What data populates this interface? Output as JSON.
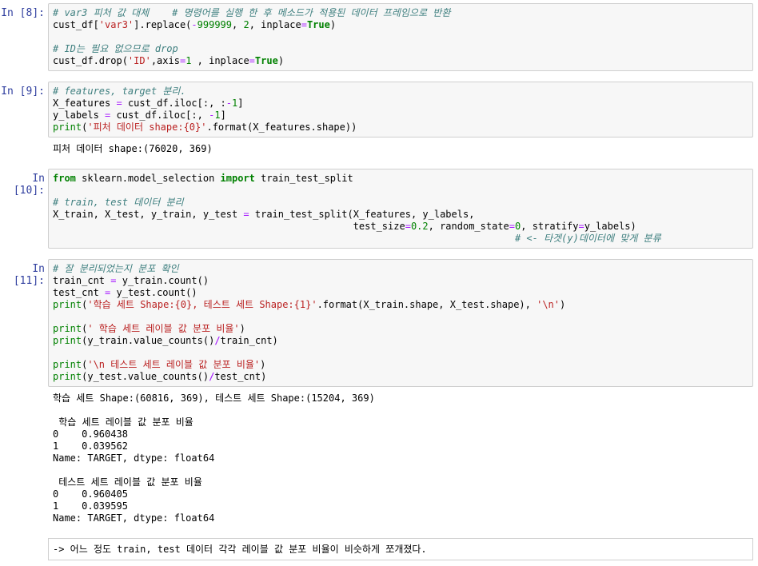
{
  "cells": [
    {
      "prompt": "In [8]:",
      "lines": [
        "# var3 피처 값 대체    # 명령어를 실행 한 후 메소드가 적용된 데이터 프레임으로 반환",
        "cust_df['var3'].replace(-999999, 2, inplace=True)",
        "",
        "# ID는 필요 없으므로 drop",
        "cust_df.drop('ID',axis=1 , inplace=True)"
      ]
    },
    {
      "prompt": "In [9]:",
      "lines": [
        "# features, target 분리.",
        "X_features = cust_df.iloc[:, :-1]",
        "y_labels = cust_df.iloc[:, -1]",
        "print('피처 데이터 shape:{0}'.format(X_features.shape))"
      ],
      "output": [
        "피처 데이터 shape:(76020, 369)"
      ]
    },
    {
      "prompt": "In [10]:",
      "lines": [
        "from sklearn.model_selection import train_test_split",
        "",
        "# train, test 데이터 분리",
        "X_train, X_test, y_train, y_test = train_test_split(X_features, y_labels,",
        "                                                    test_size=0.2, random_state=0, stratify=y_labels)",
        "                                                                                # <- 타겟(y)데이터에 맞게 분류"
      ]
    },
    {
      "prompt": "In [11]:",
      "lines": [
        "# 잘 분리되었는지 분포 확인",
        "train_cnt = y_train.count()",
        "test_cnt = y_test.count()",
        "print('학습 세트 Shape:{0}, 테스트 세트 Shape:{1}'.format(X_train.shape, X_test.shape), '\\n')",
        "",
        "print(' 학습 세트 레이블 값 분포 비율')",
        "print(y_train.value_counts()/train_cnt)",
        "",
        "print('\\n 테스트 세트 레이블 값 분포 비율')",
        "print(y_test.value_counts()/test_cnt)"
      ],
      "output": [
        "학습 세트 Shape:(60816, 369), 테스트 세트 Shape:(15204, 369)",
        "",
        " 학습 세트 레이블 값 분포 비율",
        "0    0.960438",
        "1    0.039562",
        "Name: TARGET, dtype: float64",
        "",
        " 테스트 세트 레이블 값 분포 비율",
        "0    0.960405",
        "1    0.039595",
        "Name: TARGET, dtype: float64"
      ]
    }
  ],
  "markdown": {
    "text": "-> 어느 정도 train, test 데이터 각각 레이블 값 분포 비율이 비슷하게 쪼개졌다."
  }
}
